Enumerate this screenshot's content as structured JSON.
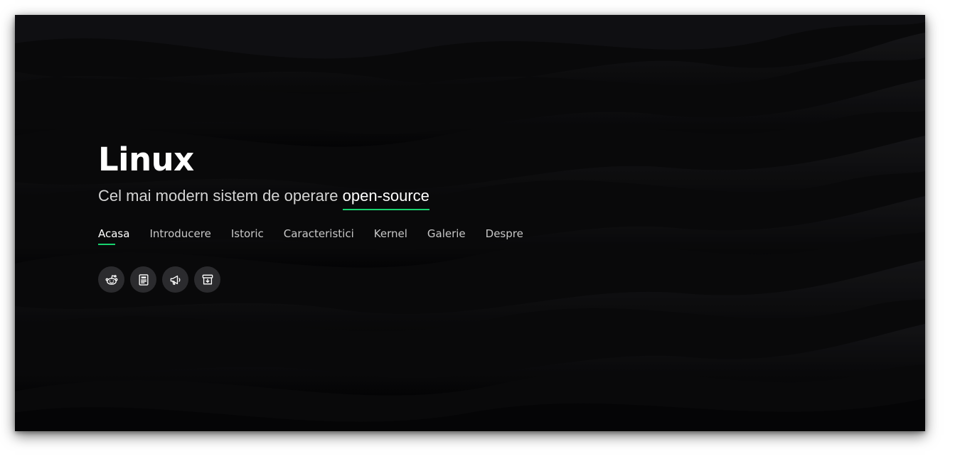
{
  "hero": {
    "title": "Linux",
    "subtitle_prefix": "Cel mai modern sistem de operare",
    "subtitle_typed": "open-source"
  },
  "nav": {
    "items": [
      {
        "label": "Acasa",
        "active": true
      },
      {
        "label": "Introducere",
        "active": false
      },
      {
        "label": "Istoric",
        "active": false
      },
      {
        "label": "Caracteristici",
        "active": false
      },
      {
        "label": "Kernel",
        "active": false
      },
      {
        "label": "Galerie",
        "active": false
      },
      {
        "label": "Despre",
        "active": false
      }
    ]
  },
  "social": [
    {
      "icon": "reddit-icon"
    },
    {
      "icon": "newspaper-icon"
    },
    {
      "icon": "megaphone-icon"
    },
    {
      "icon": "archive-download-icon"
    }
  ],
  "colors": {
    "background": "#0c0c0e",
    "accent": "#18d26e",
    "text": "#ffffff",
    "muted_text": "#c8c8c8",
    "icon_bg": "#2b2b2e"
  }
}
